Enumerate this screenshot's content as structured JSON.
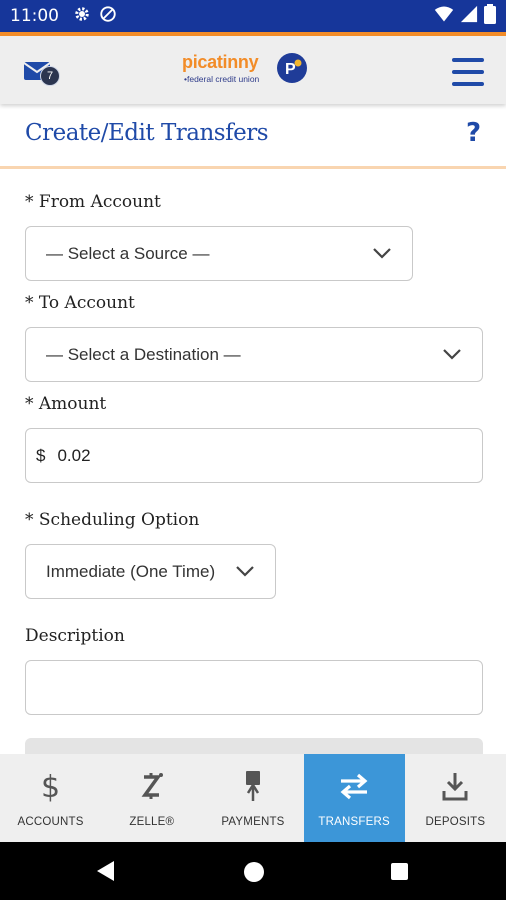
{
  "status_bar": {
    "time": "11:00",
    "background": "#16369a"
  },
  "header": {
    "inbox_badge": "7",
    "logo_name": "picatinny",
    "logo_subtitle": "•federal credit union",
    "logo_mark_letter": "P",
    "accent": "#f28c28",
    "brand": "#1f4aa8"
  },
  "page": {
    "title": "Create/Edit Transfers",
    "help_icon": "?"
  },
  "form": {
    "from_account": {
      "label": "* From Account",
      "value": "— Select a Source —"
    },
    "to_account": {
      "label": "* To Account",
      "value": "— Select a Destination —"
    },
    "amount": {
      "label": "* Amount",
      "currency": "$",
      "value": "0.02"
    },
    "scheduling": {
      "label": "* Scheduling Option",
      "value": "Immediate (One Time)"
    },
    "description": {
      "label": "Description",
      "value": ""
    }
  },
  "bottom_nav": {
    "items": [
      {
        "label": "ACCOUNTS",
        "icon": "dollar-icon",
        "active": false
      },
      {
        "label": "ZELLE®",
        "icon": "zelle-icon",
        "active": false
      },
      {
        "label": "PAYMENTS",
        "icon": "payments-icon",
        "active": false
      },
      {
        "label": "TRANSFERS",
        "icon": "transfer-arrows-icon",
        "active": true
      },
      {
        "label": "DEPOSITS",
        "icon": "download-icon",
        "active": false
      }
    ],
    "active_color": "#3c96d8"
  }
}
